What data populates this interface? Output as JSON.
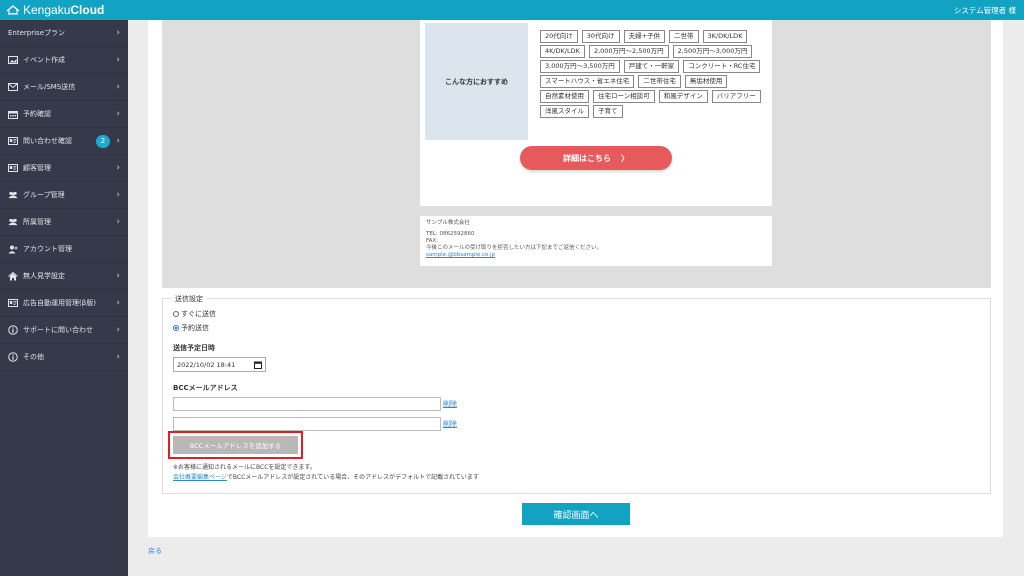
{
  "header": {
    "logo_light": "Kengaku",
    "logo_bold": "Cloud",
    "user": "システム管理者 様"
  },
  "sidebar": {
    "items": [
      {
        "label": "Enterpriseプラン",
        "icon": "none",
        "chevron": true
      },
      {
        "label": "イベント作成",
        "icon": "image-icon",
        "chevron": true
      },
      {
        "label": "メール/SMS送信",
        "icon": "mail-icon",
        "chevron": true
      },
      {
        "label": "予約確認",
        "icon": "calendar-icon",
        "chevron": true
      },
      {
        "label": "問い合わせ確認",
        "icon": "id-card-icon",
        "chevron": true,
        "badge": "2"
      },
      {
        "label": "顧客管理",
        "icon": "id-card-icon",
        "chevron": true
      },
      {
        "label": "グループ管理",
        "icon": "users-icon",
        "chevron": true
      },
      {
        "label": "所属管理",
        "icon": "users-icon",
        "chevron": true
      },
      {
        "label": "アカウント管理",
        "icon": "user-plus-icon",
        "chevron": false
      },
      {
        "label": "無人見学設定",
        "icon": "home-icon",
        "chevron": true
      },
      {
        "label": "広告自動運用管理(β版)",
        "icon": "id-card-icon",
        "chevron": true
      },
      {
        "label": "サポートに問い合わせ",
        "icon": "info-icon",
        "chevron": true
      },
      {
        "label": "その他",
        "icon": "info-icon",
        "chevron": true
      }
    ]
  },
  "email_preview": {
    "recommend_label": "こんな方におすすめ",
    "tags": [
      "20代向け",
      "30代向け",
      "夫婦+子供",
      "二世帯",
      "3K/DK/LDK",
      "4K/DK/LDK",
      "2,000万円〜2,500万円",
      "2,500万円〜3,000万円",
      "3,000万円〜3,500万円",
      "戸建て・一軒家",
      "コンクリート・RC住宅",
      "スマートハウス・省エネ住宅",
      "二世帯住宅",
      "無垢材使用",
      "自然素材使用",
      "住宅ローン相談可",
      "和風デザイン",
      "バリアフリー",
      "洋風スタイル",
      "子育て"
    ],
    "detail_button": "詳細はこちら",
    "footer": {
      "company": "サンプル株式会社",
      "tel": "TEL: 0862592860",
      "fax": "FAX:",
      "unsubscribe": "今後このメールの受け取りを拒否したい方は下記までご返信ください。",
      "email": "sample.@bbsample.co.jp"
    }
  },
  "send_settings": {
    "legend": "送信設定",
    "options": [
      {
        "label": "すぐに送信",
        "checked": false
      },
      {
        "label": "予約送信",
        "checked": true
      }
    ],
    "schedule_label": "送信予定日時",
    "schedule_value": "2022/10/02 18:41",
    "bcc_label": "BCCメールアドレス",
    "bcc_fields": [
      {
        "value": "",
        "delete_label": "削除"
      },
      {
        "value": "",
        "delete_label": "削除"
      }
    ],
    "add_bcc_button": "BCCメールアドレスを追加する",
    "note1": "※お客様に通知されるメールにBCCを設定できます。",
    "note2_link": "会社概要編集ページ",
    "note2_text": "でBCCメールアドレスが設定されている場合、そのアドレスがデフォルトで記載されています"
  },
  "confirm_button": "確認画面へ",
  "back_link": "戻る"
}
